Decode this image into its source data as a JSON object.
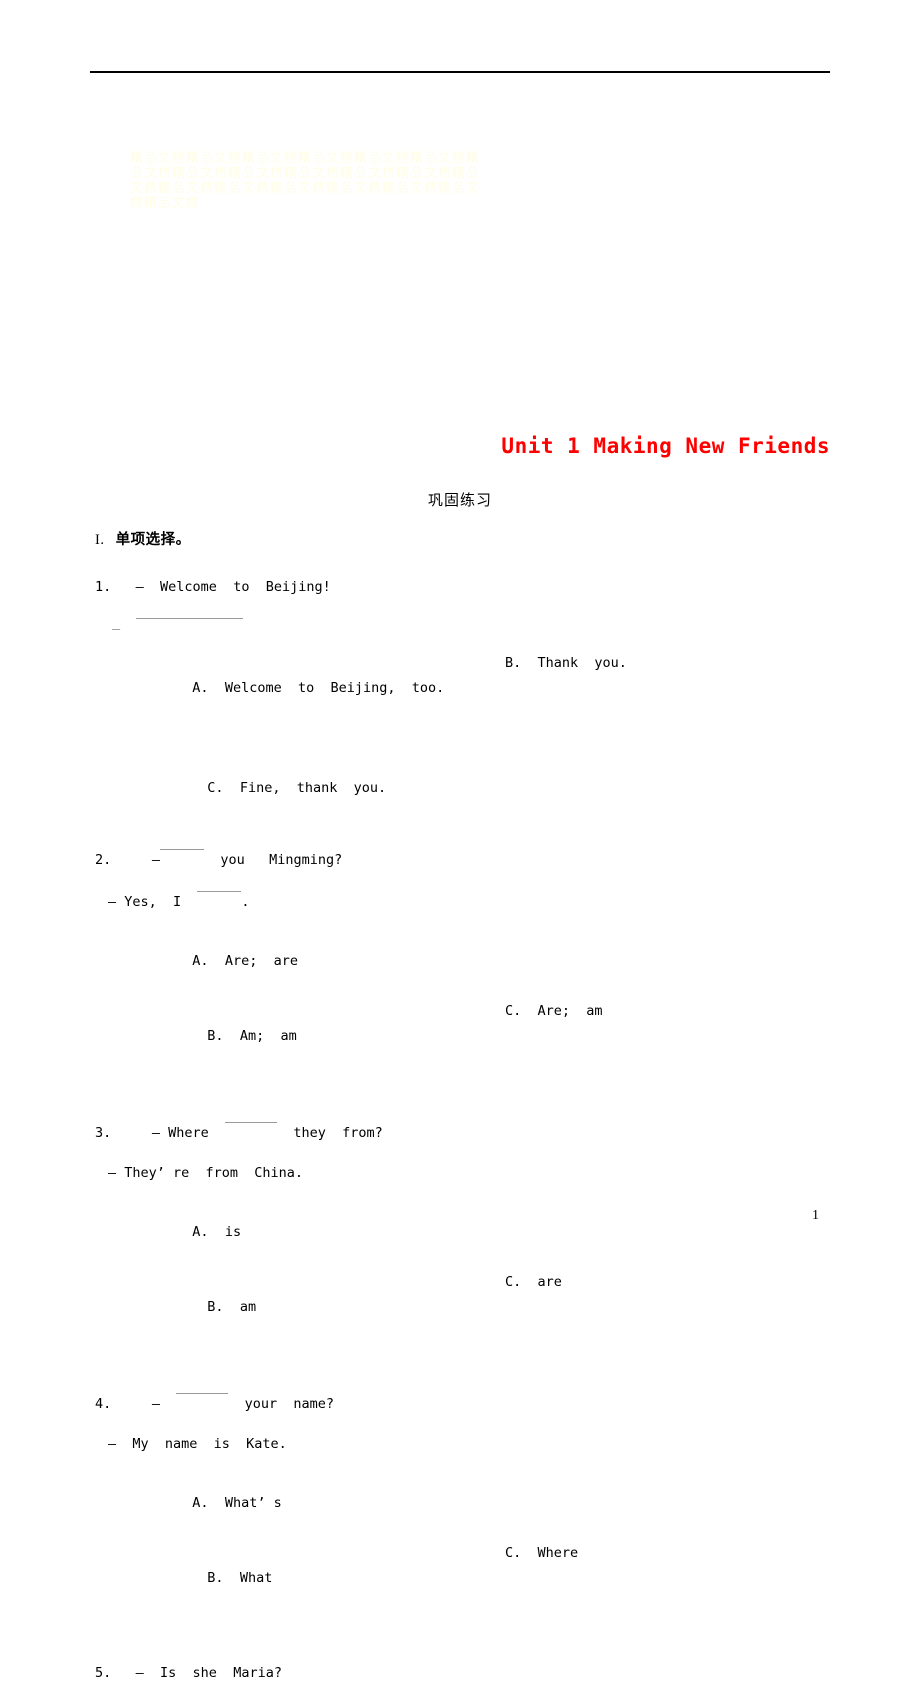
{
  "document": {
    "title": "Unit 1 Making New Friends",
    "title_color": "#ff0000",
    "subtitle": "巩固练习",
    "page_number": "1",
    "watermark_text": "精品文档精品文档精品文档精品文档精品文档精品文档精品文档精品文档精品文档精品文档精品文档精品文档精品文档精品文档精品文档精品文档精品文档精品文档精品文档精品文档"
  },
  "section": {
    "roman": "I.",
    "label": "单项选择。"
  },
  "questions": [
    {
      "number": "1.",
      "stem": "—  Welcome  to  Beijing!",
      "reply_prefix": "—",
      "reply_blank": true,
      "options": [
        {
          "letter": "A.",
          "text": "Welcome  to  Beijing,  too."
        },
        {
          "letter": "B.",
          "text": "Thank  you."
        },
        {
          "letter": "C.",
          "text": "Fine,  thank  you."
        }
      ],
      "layout": "A-B / C"
    },
    {
      "number": "2.",
      "stem_before": "—",
      "stem_after": "you   Mingming?",
      "reply_before": "— Yes,  I",
      "reply_after": ".",
      "options": [
        {
          "letter": "A.",
          "text": "Are;  are"
        },
        {
          "letter": "B.",
          "text": "Am;  am"
        },
        {
          "letter": "C.",
          "text": "Are;  am"
        }
      ],
      "layout": "A / B-C"
    },
    {
      "number": "3.",
      "stem_before": "— Where",
      "stem_after": "they  from?",
      "reply": "— They’ re  from  China.",
      "options": [
        {
          "letter": "A.",
          "text": "is"
        },
        {
          "letter": "B.",
          "text": "am"
        },
        {
          "letter": "C.",
          "text": "are"
        }
      ],
      "layout": "A / B-C"
    },
    {
      "number": "4.",
      "stem_before": "—",
      "stem_after": "your  name?",
      "reply": "—  My  name  is  Kate.",
      "options": [
        {
          "letter": "A.",
          "text": "What’ s"
        },
        {
          "letter": "B.",
          "text": "What"
        },
        {
          "letter": "C.",
          "text": "Where"
        }
      ],
      "layout": "A / B-C"
    },
    {
      "number": "5.",
      "stem": "—  Is  she  Maria?"
    }
  ]
}
